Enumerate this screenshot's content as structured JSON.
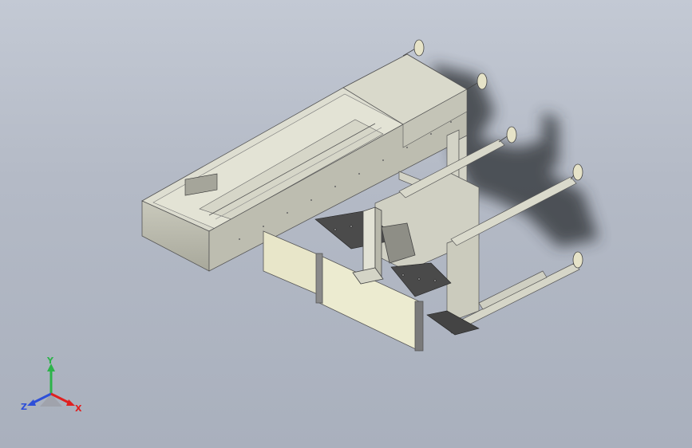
{
  "viewport": {
    "background_top": "#c3c9d4",
    "background_bottom": "#a9b0bd"
  },
  "model": {
    "colors": {
      "sheet_metal": "#dcdccf",
      "sheet_metal_dark": "#a9a99c",
      "panel_cream": "#e8e6c9",
      "dark_plate": "#4a4a4a",
      "shadow": "#3a3c40"
    }
  },
  "triad": {
    "y_label": "Y",
    "z_label": "Z",
    "x_label": "X",
    "y_color": "#2db34a",
    "z_color": "#2d4fd8",
    "x_color": "#e02020"
  }
}
